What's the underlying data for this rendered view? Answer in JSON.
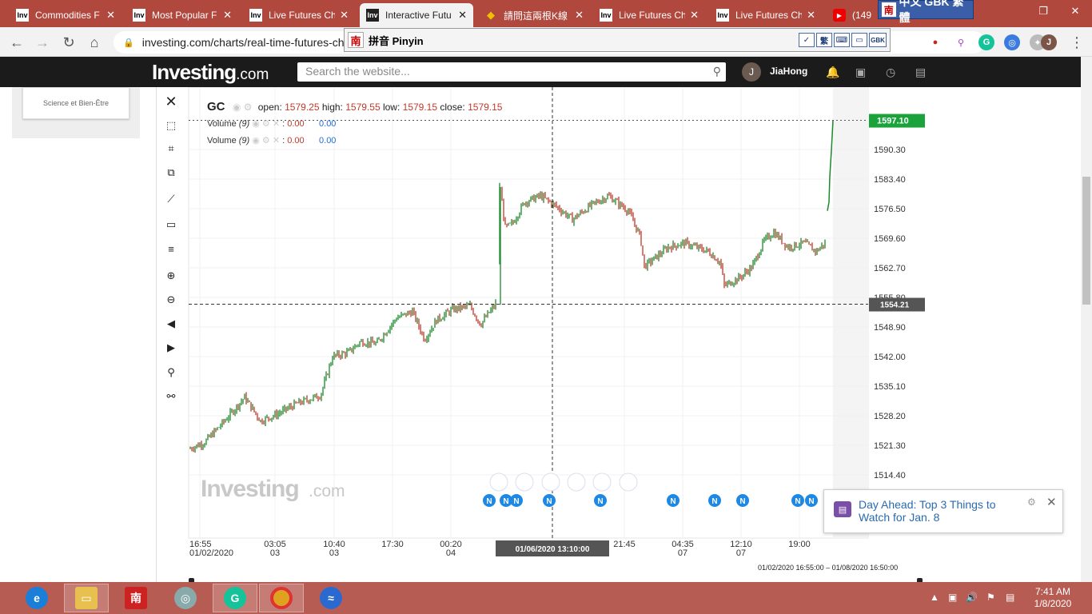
{
  "browser": {
    "tabs": [
      {
        "fav": "Inv",
        "label": "Commodities F",
        "active": false
      },
      {
        "fav": "Inv",
        "label": "Most Popular F",
        "active": false
      },
      {
        "fav": "Inv",
        "label": "Live Futures Ch",
        "active": false
      },
      {
        "fav": "Inv",
        "label": "Interactive Futu",
        "active": true
      },
      {
        "fav": "◆",
        "label": "請問這兩根K線",
        "active": false
      },
      {
        "fav": "Inv",
        "label": "Live Futures Ch",
        "active": false
      },
      {
        "fav": "Inv",
        "label": "Live Futures Ch",
        "active": false
      },
      {
        "fav": "▶",
        "label": "(149)",
        "active": false
      }
    ],
    "url": "investing.com/charts/real-time-futures-ch",
    "profile_initial": "J"
  },
  "ime": {
    "top_label": "中文 GBK 繁體",
    "nan": "南",
    "pinyin": "拼音 Pinyin",
    "buttons": [
      "✓",
      "繁",
      "⌨",
      "▭",
      "GBK"
    ]
  },
  "site": {
    "logo_main": "Investing",
    "logo_domain": ".com",
    "search_placeholder": "Search the website...",
    "user_initial": "J",
    "user_name": "JiaHong",
    "sidebar_card": "Science et Bien-Être"
  },
  "chart": {
    "symbol": "GC",
    "ohlc": {
      "open_label": "open:",
      "open": "1579.25",
      "high_label": "high:",
      "high": "1579.55",
      "low_label": "low:",
      "low": "1579.15",
      "close_label": "close:",
      "close": "1579.15"
    },
    "volume_rows": [
      {
        "label": "Volume",
        "param": "(9)",
        "v1": "0.00",
        "v2": "0.00"
      },
      {
        "label": "Volume",
        "param": "(9)",
        "v1": "0.00",
        "v2": "0.00"
      }
    ],
    "y_ticks": [
      "1590.30",
      "1583.40",
      "1576.50",
      "1569.60",
      "1562.70",
      "1555.80",
      "1548.90",
      "1542.00",
      "1535.10",
      "1528.20",
      "1521.30",
      "1514.40"
    ],
    "current_price": "1597.10",
    "crosshair_price": "1554.21",
    "crosshair_time": "01/06/2020 13:10:00",
    "x_ticks": [
      {
        "time": "16:55",
        "date": "01/02/2020"
      },
      {
        "time": "03:05",
        "date": "03"
      },
      {
        "time": "10:40",
        "date": "03"
      },
      {
        "time": "17:30",
        "date": ""
      },
      {
        "time": "00:20",
        "date": "04"
      },
      {
        "time": "21:45",
        "date": ""
      },
      {
        "time": "04:35",
        "date": "07"
      },
      {
        "time": "12:10",
        "date": "07"
      },
      {
        "time": "19:00",
        "date": ""
      }
    ],
    "range_label": "01/02/2020 16:55:00 – 01/08/2020 16:50:00",
    "watermark_main": "Investing",
    "watermark_domain": ".com",
    "news_marker": "N",
    "colors": {
      "up": "#1a8a2a",
      "down": "#c0392b",
      "current": "#1aa33a",
      "crosshair_bg": "#555555",
      "navigator_fill": "#fde8b8"
    }
  },
  "toast": {
    "title": "Day Ahead: Top 3 Things to Watch for Jan. 8"
  },
  "taskbar": {
    "time": "7:41 AM",
    "date": "1/8/2020"
  }
}
